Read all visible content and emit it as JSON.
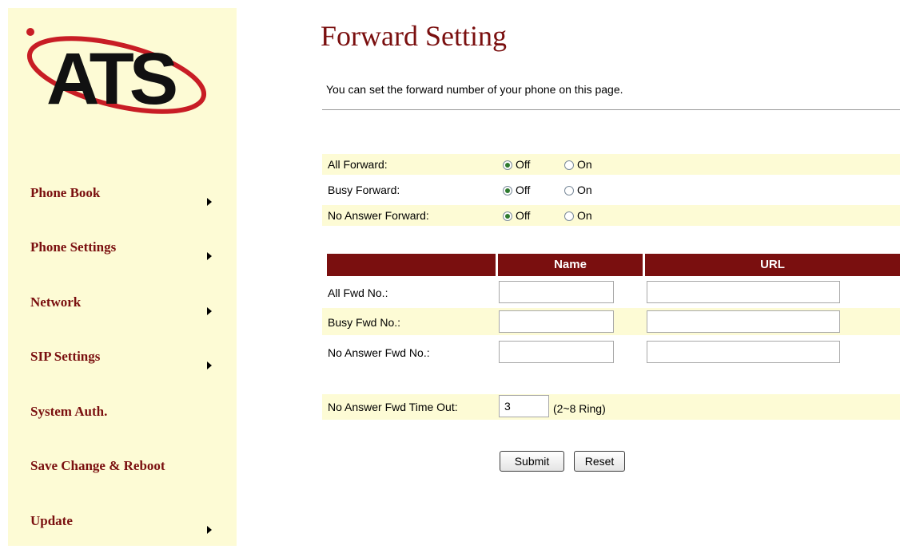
{
  "logo": {
    "text": "ATS"
  },
  "sidebar": {
    "items": [
      {
        "label": "Phone Book",
        "has_arrow": true
      },
      {
        "label": "Phone Settings",
        "has_arrow": true
      },
      {
        "label": "Network",
        "has_arrow": true
      },
      {
        "label": "SIP Settings",
        "has_arrow": true
      },
      {
        "label": "System Auth.",
        "has_arrow": false
      },
      {
        "label": "Save Change & Reboot",
        "has_arrow": false
      },
      {
        "label": "Update",
        "has_arrow": true
      }
    ]
  },
  "page": {
    "title": "Forward Setting",
    "description": "You can set the forward number of your phone on this page."
  },
  "forward_options": [
    {
      "label": "All Forward:",
      "off_label": "Off",
      "on_label": "On",
      "selected": "Off"
    },
    {
      "label": "Busy Forward:",
      "off_label": "Off",
      "on_label": "On",
      "selected": "Off"
    },
    {
      "label": "No Answer Forward:",
      "off_label": "Off",
      "on_label": "On",
      "selected": "Off"
    }
  ],
  "fwd_table": {
    "headers": [
      "",
      "Name",
      "URL"
    ],
    "rows": [
      {
        "label": "All Fwd No.:",
        "name": "",
        "url": ""
      },
      {
        "label": "Busy Fwd No.:",
        "name": "",
        "url": ""
      },
      {
        "label": "No Answer Fwd No.:",
        "name": "",
        "url": ""
      }
    ]
  },
  "timeout": {
    "label": "No Answer Fwd Time Out:",
    "value": "3",
    "hint": "(2~8 Ring)"
  },
  "buttons": {
    "submit": "Submit",
    "reset": "Reset"
  },
  "colors": {
    "sidebar_bg": "#fdfbd5",
    "accent": "#7a0f0f",
    "band_bg": "#fdfbd5"
  }
}
